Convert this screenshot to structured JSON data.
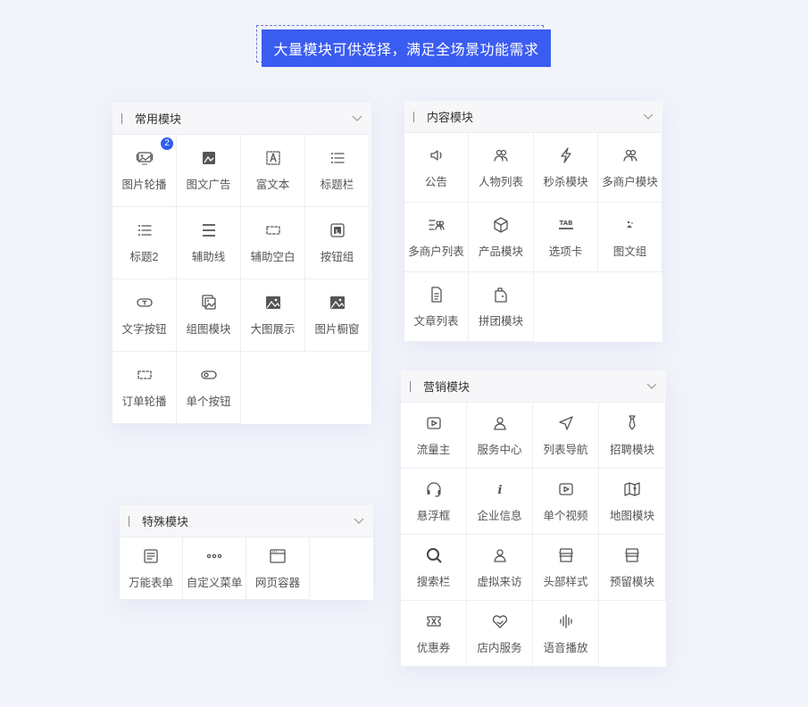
{
  "banner": {
    "text": "大量模块可供选择，满足全场景功能需求"
  },
  "panels": {
    "common": {
      "title": "常用模块",
      "items": [
        {
          "label": "图片轮播",
          "icon": "image-carousel-icon",
          "badge": "2"
        },
        {
          "label": "图文广告",
          "icon": "image-text-ad-icon"
        },
        {
          "label": "富文本",
          "icon": "rich-text-icon"
        },
        {
          "label": "标题栏",
          "icon": "title-bar-icon"
        },
        {
          "label": "标题2",
          "icon": "title-list-icon"
        },
        {
          "label": "辅助线",
          "icon": "divider-line-icon"
        },
        {
          "label": "辅助空白",
          "icon": "blank-space-icon"
        },
        {
          "label": "按钮组",
          "icon": "button-group-icon"
        },
        {
          "label": "文字按钮",
          "icon": "text-button-icon"
        },
        {
          "label": "组图模块",
          "icon": "image-group-icon"
        },
        {
          "label": "大图展示",
          "icon": "large-image-icon"
        },
        {
          "label": "图片橱窗",
          "icon": "image-window-icon"
        },
        {
          "label": "订单轮播",
          "icon": "order-carousel-icon"
        },
        {
          "label": "单个按钮",
          "icon": "toggle-button-icon"
        }
      ]
    },
    "content": {
      "title": "内容模块",
      "items": [
        {
          "label": "公告",
          "icon": "speaker-icon"
        },
        {
          "label": "人物列表",
          "icon": "people-icon"
        },
        {
          "label": "秒杀模块",
          "icon": "lightning-icon"
        },
        {
          "label": "多商户模块",
          "icon": "merchants-icon"
        },
        {
          "label": "多商户列表",
          "icon": "merchant-list-icon"
        },
        {
          "label": "产品模块",
          "icon": "product-box-icon"
        },
        {
          "label": "选项卡",
          "icon": "tab-icon"
        },
        {
          "label": "图文组",
          "icon": "image-text-group-icon"
        },
        {
          "label": "文章列表",
          "icon": "document-icon"
        },
        {
          "label": "拼团模块",
          "icon": "group-buy-tag-icon"
        }
      ]
    },
    "marketing": {
      "title": "营销模块",
      "items": [
        {
          "label": "流量主",
          "icon": "video-play-icon"
        },
        {
          "label": "服务中心",
          "icon": "service-person-icon"
        },
        {
          "label": "列表导航",
          "icon": "navigation-arrow-icon"
        },
        {
          "label": "招聘模块",
          "icon": "recruit-tie-icon"
        },
        {
          "label": "悬浮框",
          "icon": "headset-icon"
        },
        {
          "label": "企业信息",
          "icon": "info-icon"
        },
        {
          "label": "单个视频",
          "icon": "single-video-icon"
        },
        {
          "label": "地图模块",
          "icon": "map-icon"
        },
        {
          "label": "搜索栏",
          "icon": "search-icon"
        },
        {
          "label": "虚拟来访",
          "icon": "visitor-icon"
        },
        {
          "label": "头部样式",
          "icon": "store-header-icon"
        },
        {
          "label": "预留模块",
          "icon": "reserved-store-icon"
        },
        {
          "label": "优惠券",
          "icon": "coupon-icon"
        },
        {
          "label": "店内服务",
          "icon": "heart-hands-icon"
        },
        {
          "label": "语音播放",
          "icon": "audio-wave-icon"
        }
      ]
    },
    "special": {
      "title": "特殊模块",
      "items": [
        {
          "label": "万能表单",
          "icon": "form-icon"
        },
        {
          "label": "自定义菜单",
          "icon": "dots-menu-icon"
        },
        {
          "label": "网页容器",
          "icon": "browser-window-icon"
        }
      ]
    }
  }
}
